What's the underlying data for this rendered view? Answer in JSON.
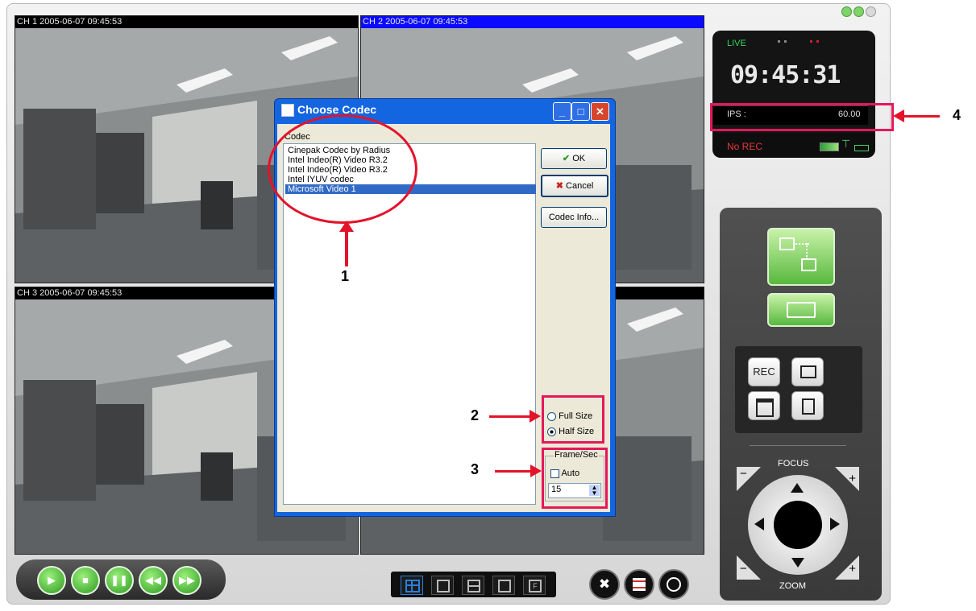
{
  "window": {
    "controls": [
      "minimize",
      "restore",
      "close"
    ]
  },
  "cameras": [
    {
      "title": "CH 1 2005-06-07 09:45:53",
      "selected": false
    },
    {
      "title": "CH 2 2005-06-07 09:45:53",
      "selected": true
    },
    {
      "title": "CH 3 2005-06-07 09:45:53",
      "selected": false
    },
    {
      "title": "",
      "selected": false
    }
  ],
  "status": {
    "mode": "LIVE",
    "clock": "09:45:31",
    "ips_label": "IPS :",
    "ips_value": "60.00",
    "rec_status": "No REC"
  },
  "control_panel": {
    "rec_button": "REC",
    "focus_label": "FOCUS",
    "zoom_label": "ZOOM",
    "minus": "−",
    "plus": "+"
  },
  "dialog": {
    "title": "Choose Codec",
    "list_label": "Codec",
    "codecs": [
      "Cinepak Codec by Radius",
      "Intel Indeo(R) Video R3.2",
      "Intel Indeo(R) Video R3.2",
      "Intel IYUV codec",
      "Microsoft Video 1"
    ],
    "selected_index": 4,
    "ok_label": "OK",
    "cancel_label": "Cancel",
    "info_label": "Codec Info...",
    "size_options": [
      "Full Size",
      "Half Size"
    ],
    "size_selected": "Half Size",
    "fps_group_label": "Frame/Sec",
    "auto_label": "Auto",
    "auto_checked": false,
    "fps_value": "15"
  },
  "annotations": [
    "1",
    "2",
    "3",
    "4"
  ],
  "colors": {
    "accent_red": "#e4185a",
    "title_blue": "#0a0aff",
    "green": "#58b83e"
  }
}
